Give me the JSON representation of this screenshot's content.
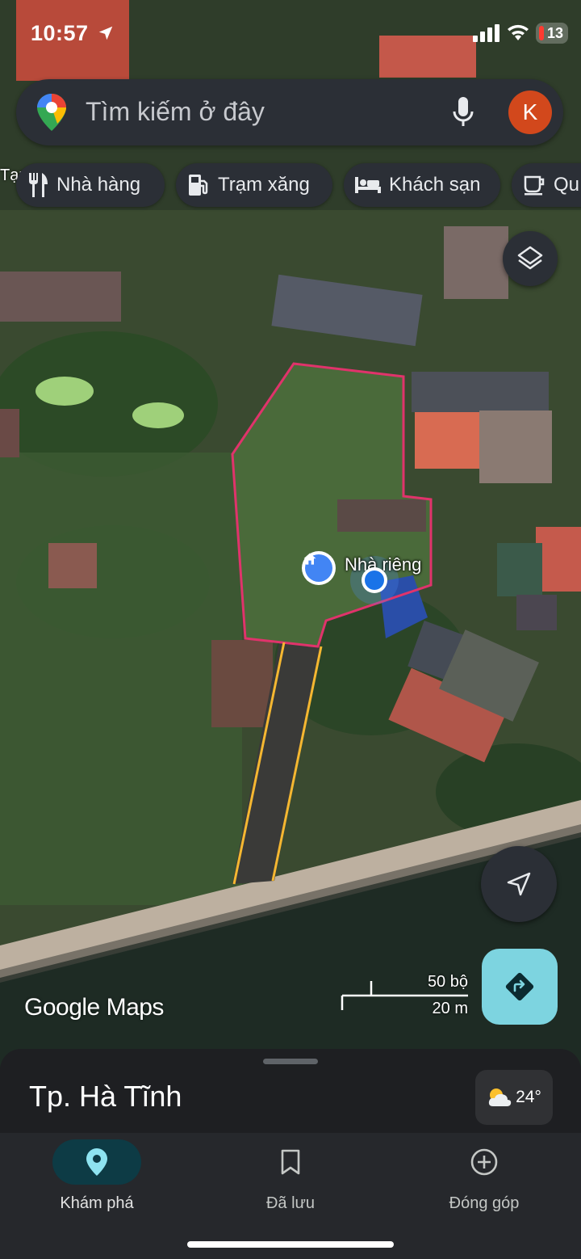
{
  "status_bar": {
    "time": "10:57",
    "battery": "13",
    "icons": [
      "location-arrow-icon",
      "signal-icon",
      "wifi-icon",
      "battery-icon"
    ]
  },
  "search": {
    "placeholder": "Tìm kiếm ở đây",
    "avatar_letter": "K",
    "icons": [
      "maps-pin-icon",
      "mic-icon"
    ]
  },
  "chips": [
    {
      "label": "Nhà hàng",
      "icon": "restaurant-icon"
    },
    {
      "label": "Trạm xăng",
      "icon": "gas-station-icon"
    },
    {
      "label": "Khách sạn",
      "icon": "hotel-icon"
    },
    {
      "label": "Qu",
      "icon": "coffee-icon"
    }
  ],
  "map": {
    "left_edge_label": "Tạp",
    "place_label": "Nhà riêng",
    "logo": "Google Maps",
    "scale": {
      "feet": "50 bộ",
      "meters": "20 m"
    },
    "polygon_color": "#e0336b",
    "road_line_color": "#f5b731"
  },
  "sheet": {
    "title": "Tp. Hà Tĩnh",
    "temperature": "24°"
  },
  "nav": [
    {
      "label": "Khám phá",
      "icon": "explore-pin-icon",
      "active": true
    },
    {
      "label": "Đã lưu",
      "icon": "bookmark-icon",
      "active": false
    },
    {
      "label": "Đóng góp",
      "icon": "add-circle-icon",
      "active": false
    }
  ],
  "colors": {
    "accent": "#7dd4e0",
    "avatar": "#d2481c",
    "location_dot": "#1a73e8"
  }
}
